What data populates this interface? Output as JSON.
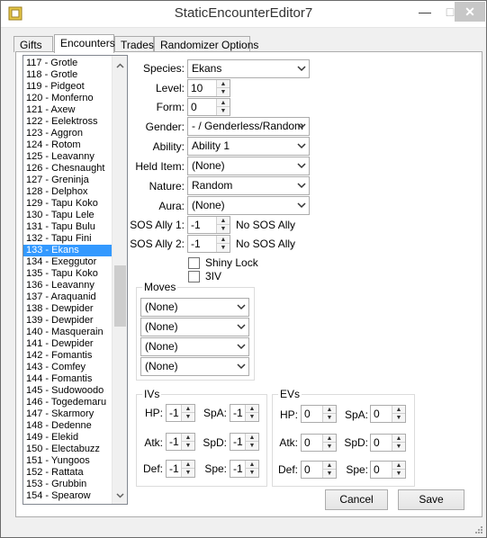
{
  "window": {
    "title": "StaticEncounterEditor7"
  },
  "tabs": [
    "Gifts",
    "Encounters",
    "Trades",
    "Randomizer Options"
  ],
  "species_list": {
    "items": [
      "117 - Grotle",
      "118 - Grotle",
      "119 - Pidgeot",
      "120 - Monferno",
      "121 - Axew",
      "122 - Eelektross",
      "123 - Aggron",
      "124 - Rotom",
      "125 - Leavanny",
      "126 - Chesnaught",
      "127 - Greninja",
      "128 - Delphox",
      "129 - Tapu Koko",
      "130 - Tapu Lele",
      "131 - Tapu Bulu",
      "132 - Tapu Fini",
      "133 - Ekans",
      "134 - Exeggutor",
      "135 - Tapu Koko",
      "136 - Leavanny",
      "137 - Araquanid",
      "138 - Dewpider",
      "139 - Dewpider",
      "140 - Masquerain",
      "141 - Dewpider",
      "142 - Fomantis",
      "143 - Comfey",
      "144 - Fomantis",
      "145 - Sudowoodo",
      "146 - Togedemaru",
      "147 - Skarmory",
      "148 - Dedenne",
      "149 - Elekid",
      "150 - Electabuzz",
      "151 - Yungoos",
      "152 - Rattata",
      "153 - Grubbin",
      "154 - Spearow"
    ],
    "selected": "133 - Ekans"
  },
  "form": {
    "species": {
      "label": "Species:",
      "value": "Ekans"
    },
    "level": {
      "label": "Level:",
      "value": "10"
    },
    "form": {
      "label": "Form:",
      "value": "0"
    },
    "gender": {
      "label": "Gender:",
      "value": "- / Genderless/Random"
    },
    "ability": {
      "label": "Ability:",
      "value": "Ability 1"
    },
    "held_item": {
      "label": "Held Item:",
      "value": "(None)"
    },
    "nature": {
      "label": "Nature:",
      "value": "Random"
    },
    "aura": {
      "label": "Aura:",
      "value": "(None)"
    },
    "sos_ally_1": {
      "label": "SOS Ally 1:",
      "value": "-1",
      "hint": "No SOS Ally"
    },
    "sos_ally_2": {
      "label": "SOS Ally 2:",
      "value": "-1",
      "hint": "No SOS Ally"
    },
    "shiny_lock": {
      "label": "Shiny Lock",
      "checked": false
    },
    "three_iv": {
      "label": "3IV",
      "checked": false
    }
  },
  "moves": {
    "title": "Moves",
    "slots": [
      "(None)",
      "(None)",
      "(None)",
      "(None)"
    ]
  },
  "ivs": {
    "title": "IVs",
    "hp": {
      "label": "HP:",
      "value": "-1"
    },
    "atk": {
      "label": "Atk:",
      "value": "-1"
    },
    "def": {
      "label": "Def:",
      "value": "-1"
    },
    "spa": {
      "label": "SpA:",
      "value": "-1"
    },
    "spd": {
      "label": "SpD:",
      "value": "-1"
    },
    "spe": {
      "label": "Spe:",
      "value": "-1"
    }
  },
  "evs": {
    "title": "EVs",
    "hp": {
      "label": "HP:",
      "value": "0"
    },
    "atk": {
      "label": "Atk:",
      "value": "0"
    },
    "def": {
      "label": "Def:",
      "value": "0"
    },
    "spa": {
      "label": "SpA:",
      "value": "0"
    },
    "spd": {
      "label": "SpD:",
      "value": "0"
    },
    "spe": {
      "label": "Spe:",
      "value": "0"
    }
  },
  "buttons": {
    "cancel": "Cancel",
    "save": "Save"
  }
}
